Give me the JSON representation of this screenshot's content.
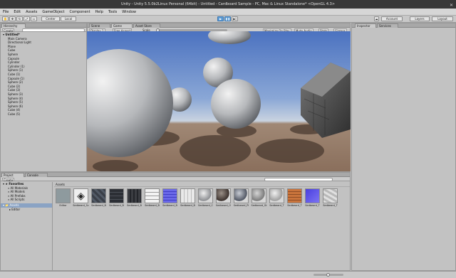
{
  "window": {
    "title": "Unity - Unity 5.5.0b2Linux Personal (64bit) - Untitled - Cardboard Sample - PC, Mac & Linux Standalone* <OpenGL 4.3>"
  },
  "menu": [
    "File",
    "Edit",
    "Assets",
    "GameObject",
    "Component",
    "Help",
    "Tools",
    "Window"
  ],
  "toolbar": {
    "tools": [
      "hand-tool",
      "move-tool",
      "rotate-tool",
      "scale-tool",
      "rect-tool"
    ],
    "pivot": "Center",
    "space": "Local",
    "account": "Account",
    "layers": "Layers",
    "layout": "Layout"
  },
  "hierarchy": {
    "tab": "Hierarchy",
    "create": "Create",
    "root": "Untitled*",
    "items": [
      "Main Camera",
      "Directional Light",
      "Plane",
      "Cube",
      "Sphere",
      "Capsule",
      "Cylinder",
      "Cylinder (1)",
      "Sphere (1)",
      "Cube (1)",
      "Capsule (1)",
      "Sphere (2)",
      "Cube (2)",
      "Cube (3)",
      "Sphere (3)",
      "Sphere (4)",
      "Sphere (5)",
      "Sphere (6)",
      "Cube (4)",
      "Cube (5)"
    ]
  },
  "views": {
    "tabs": [
      "Scene",
      "Game",
      "Asset Store"
    ],
    "active": "Game",
    "display": "Display 1",
    "aspect": "Free Aspect",
    "scale": "Scale",
    "toggles": [
      "Maximize On Play",
      "Mute Audio",
      "Stats",
      "Gizmos"
    ]
  },
  "inspector": {
    "tabs": [
      "Inspector",
      "Services"
    ]
  },
  "project": {
    "tabs": [
      "Project",
      "Console"
    ],
    "create": "Create",
    "favorites": {
      "label": "Favorites",
      "items": [
        "All Materials",
        "All Models",
        "All Prefabs",
        "All Scripts"
      ]
    },
    "assets": {
      "label": "Assets",
      "items": [
        "Editor"
      ]
    },
    "breadcrumb": "Assets",
    "grid": [
      {
        "label": "Editor",
        "kind": "folder"
      },
      {
        "label": "Sedbeard_Sc",
        "kind": "unity"
      },
      {
        "label": "Sedbeard_B",
        "kind": "dark-rock"
      },
      {
        "label": "Sedbeard_B",
        "kind": "dark-tile"
      },
      {
        "label": "Sedbeard_B",
        "kind": "dark-tile2"
      },
      {
        "label": "Sedbeard_B",
        "kind": "white-brick"
      },
      {
        "label": "Sedbeard_B",
        "kind": "blue-grid"
      },
      {
        "label": "Sedbeard_B",
        "kind": "light-grid"
      },
      {
        "label": "Sedbeard_C",
        "kind": "sphere-grey"
      },
      {
        "label": "Sedbeard_O",
        "kind": "sphere-dark"
      },
      {
        "label": "Sedbeard_Pi",
        "kind": "sphere-cracked"
      },
      {
        "label": "Sedbeard_St",
        "kind": "sphere-stone"
      },
      {
        "label": "Sedbeard_T",
        "kind": "sphere-plain"
      },
      {
        "label": "Sedbeard_T",
        "kind": "orange-brick"
      },
      {
        "label": "Sedbeard_T",
        "kind": "blue-tex"
      },
      {
        "label": "Sedbeard_T",
        "kind": "light-rock"
      }
    ]
  },
  "colors": {
    "titlebar": "#383838",
    "panel": "#c2c2c2",
    "selection": "#8aa3c4",
    "play_active": "#5b9bd5",
    "sky": "#4b72c0",
    "floor": "#8a6f5c"
  }
}
